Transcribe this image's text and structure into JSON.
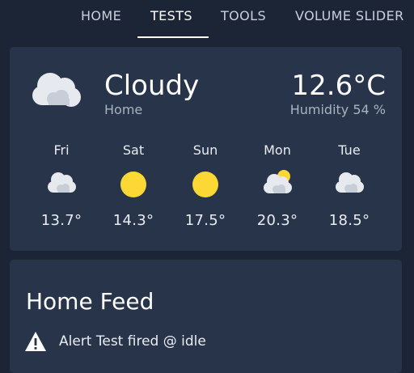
{
  "nav": {
    "tabs": [
      {
        "label": "HOME"
      },
      {
        "label": "TESTS"
      },
      {
        "label": "TOOLS"
      },
      {
        "label": "VOLUME SLIDER"
      }
    ],
    "active_tab": "TESTS"
  },
  "weather": {
    "condition": "Cloudy",
    "location": "Home",
    "temperature": "12.6°C",
    "humidity": "Humidity 54 %",
    "icon": "cloudy-icon",
    "forecast": [
      {
        "day": "Fri",
        "temp": "13.7°",
        "icon": "cloudy-icon"
      },
      {
        "day": "Sat",
        "temp": "14.3°",
        "icon": "sunny-icon"
      },
      {
        "day": "Sun",
        "temp": "17.5°",
        "icon": "sunny-icon"
      },
      {
        "day": "Mon",
        "temp": "20.3°",
        "icon": "partly-cloudy-icon"
      },
      {
        "day": "Tue",
        "temp": "18.5°",
        "icon": "cloudy-icon"
      }
    ]
  },
  "feed": {
    "title": "Home Feed",
    "items": [
      {
        "text": "Alert Test fired @ idle",
        "icon": "alert-triangle-icon"
      }
    ]
  },
  "colors": {
    "background": "#1c2536",
    "card": "#283449",
    "sun": "#fcd835",
    "cloud": "#e6e9ee"
  }
}
